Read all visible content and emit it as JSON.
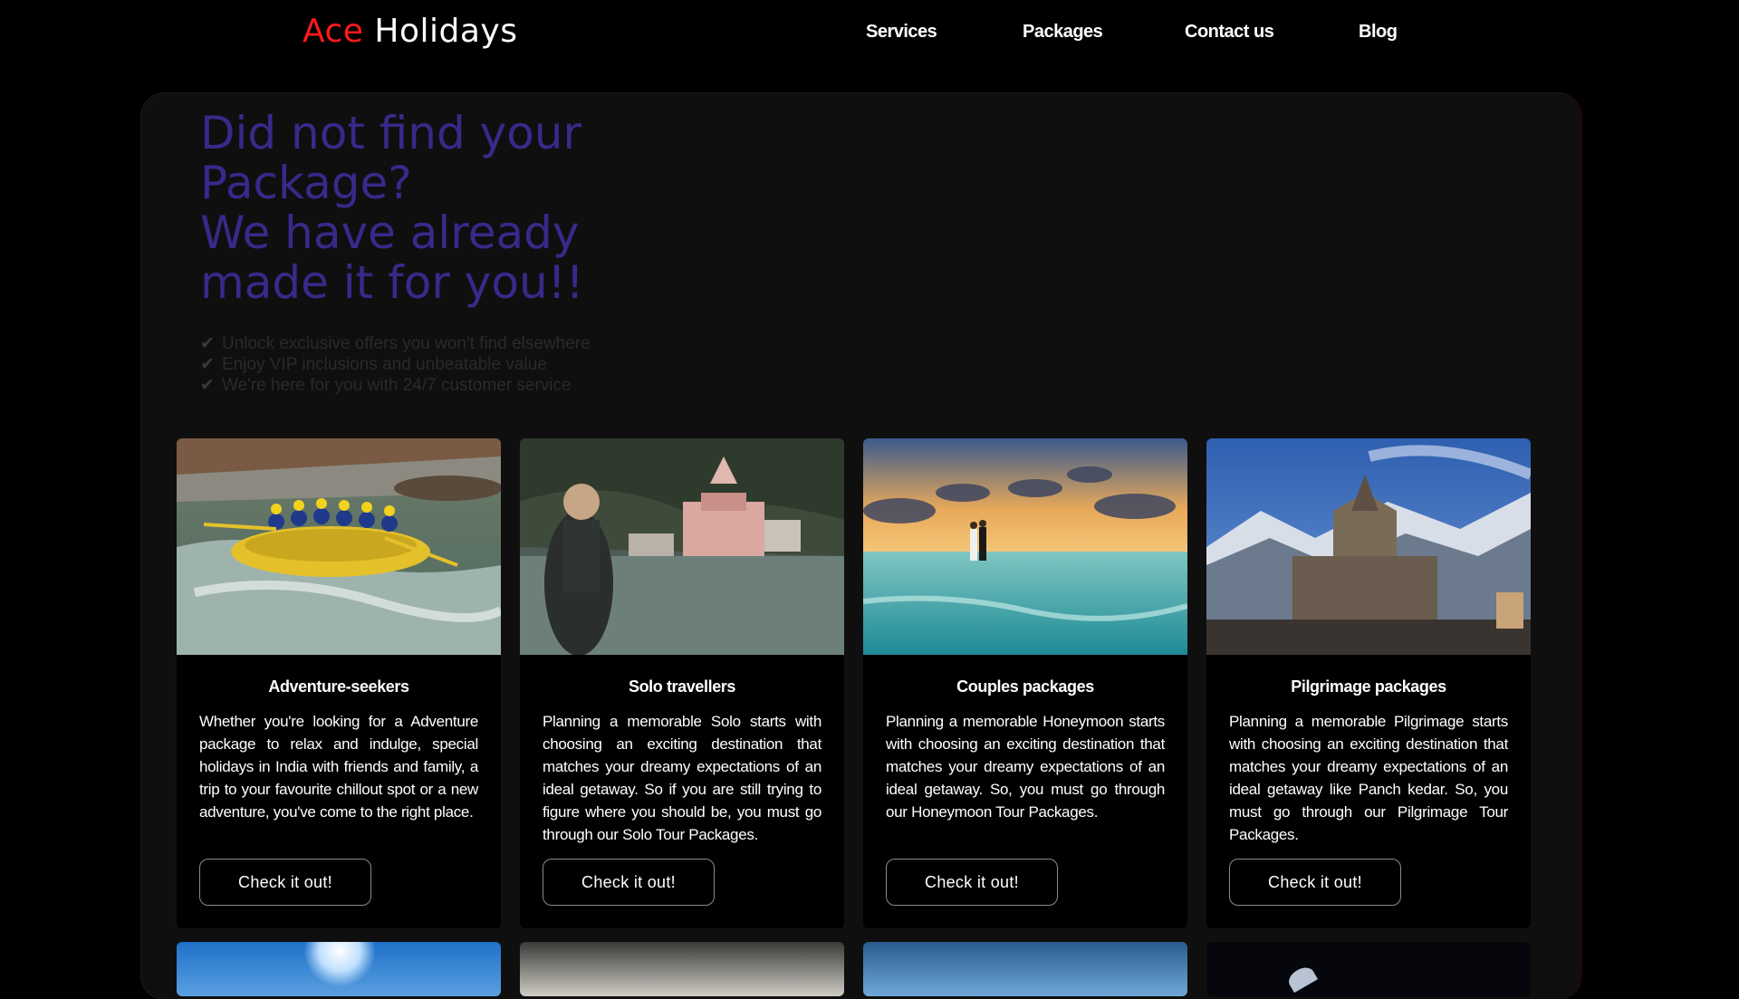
{
  "nav": {
    "logo_ace": "Ace",
    "logo_holidays": "Holidays",
    "links": [
      "Services",
      "Packages",
      "Contact us",
      "Blog"
    ]
  },
  "hero": {
    "title_lines": [
      "Did not find your",
      "Package?",
      "We have already",
      "made it for you!!"
    ],
    "bullets": [
      "Unlock exclusive offers you won't find elsewhere",
      "Enjoy VIP inclusions and unbeatable value",
      "We're here for you with 24/7 customer service"
    ]
  },
  "cards": [
    {
      "title": "Adventure-seekers",
      "text": "Whether you're looking for a Adventure package to relax and indulge, special holidays in India with friends and family, a trip to your favourite chillout spot or a new adventure, you've come to the right place.",
      "button": "Check it out!",
      "image": "river-rafting-photo"
    },
    {
      "title": "Solo travellers",
      "text": "Planning a memorable Solo starts with choosing an exciting destination that matches your dreamy expectations of an ideal getaway. So if you are still trying to figure where you should be, you must go through our Solo Tour Packages.",
      "button": "Check it out!",
      "image": "solo-traveller-river-temple-photo"
    },
    {
      "title": "Couples packages",
      "text": "Planning a memorable Honeymoon starts with choosing an exciting destination that matches your dreamy expectations of an ideal getaway. So, you must go through our Honeymoon Tour Packages.",
      "button": "Check it out!",
      "image": "couple-beach-sunset-photo"
    },
    {
      "title": "Pilgrimage packages",
      "text": "Planning a memorable Pilgrimage starts with choosing an exciting destination that matches your dreamy expectations of an ideal getaway like Panch kedar. So, you must go through our Pilgrimage Tour Packages.",
      "button": "Check it out!",
      "image": "mountain-temple-photo"
    }
  ],
  "colors": {
    "logo_accent": "#ff1a1a",
    "hero_title": "#38298a",
    "panel_bg": "#0f0f0f",
    "page_bg": "#000000"
  }
}
